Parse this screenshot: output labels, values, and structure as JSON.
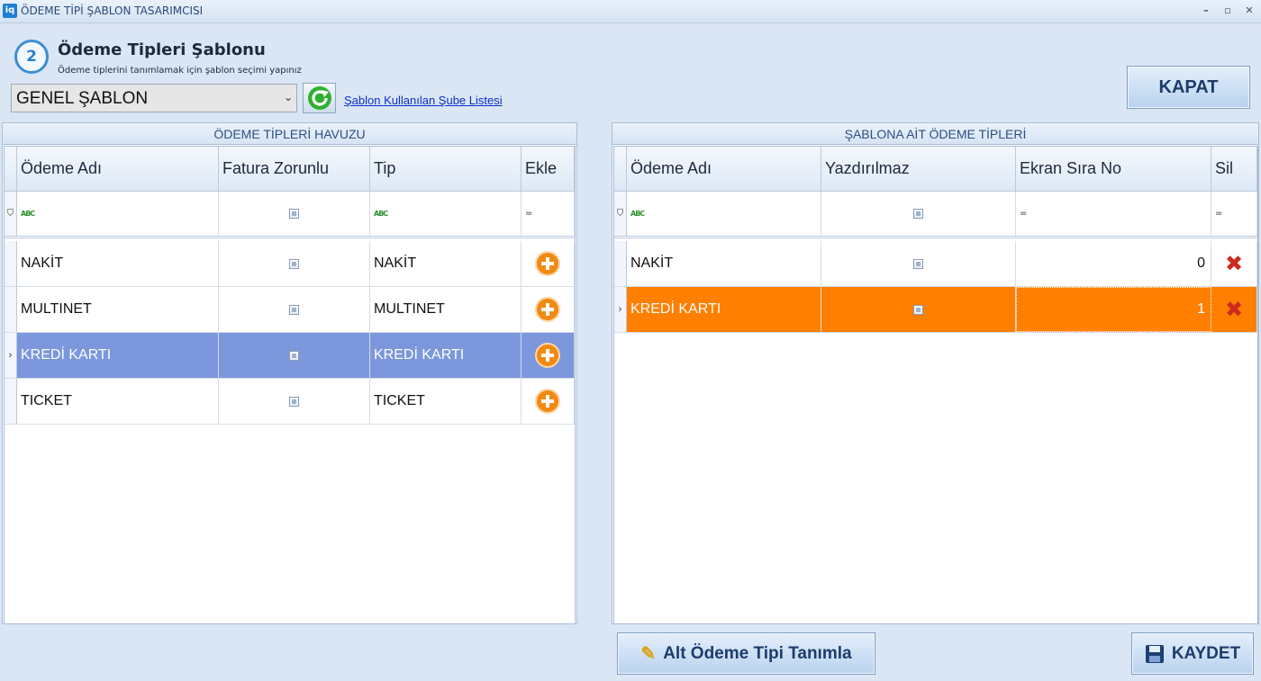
{
  "window": {
    "app_icon": "iq",
    "title": "ÖDEME TİPİ ŞABLON TASARIMCISI",
    "minimize": "–",
    "maximize": "▫",
    "close": "✕"
  },
  "header": {
    "step_number": "2",
    "title": "Ödeme Tipleri Şablonu",
    "subtitle": "Ödeme tiplerini tanımlamak için şablon seçimi yapınız"
  },
  "template_select": {
    "value": "GENEL ŞABLON",
    "arrow": "⌄"
  },
  "refresh_icon": "refresh-icon",
  "branch_link": "Şablon Kullanılan Şube Listesi",
  "close_button": "KAPAT",
  "pool": {
    "caption": "ÖDEME TİPLERİ HAVUZU",
    "columns": [
      "Ödeme Adı",
      "Fatura Zorunlu",
      "Tip",
      "Ekle"
    ],
    "filter": {
      "text_icon": "abc-filter-icon",
      "abc": "ABC",
      "equals": "="
    },
    "rows": [
      {
        "name": "NAKİT",
        "invoice_required": false,
        "type": "NAKİT"
      },
      {
        "name": "MULTINET",
        "invoice_required": false,
        "type": "MULTINET"
      },
      {
        "name": "KREDİ KARTI",
        "invoice_required": false,
        "type": "KREDİ KARTI",
        "selected": true
      },
      {
        "name": "TICKET",
        "invoice_required": false,
        "type": "TICKET"
      }
    ]
  },
  "template_types": {
    "caption": "ŞABLONA AİT ÖDEME TİPLERİ",
    "columns": [
      "Ödeme Adı",
      "Yazdırılmaz",
      "Ekran Sıra No",
      "Sil"
    ],
    "filter": {
      "abc": "ABC",
      "equals": "="
    },
    "rows": [
      {
        "name": "NAKİT",
        "not_printable": false,
        "order": "0"
      },
      {
        "name": "KREDİ KARTI",
        "not_printable": false,
        "order": "1",
        "selected": true
      }
    ]
  },
  "sub_type_button": "Alt Ödeme Tipi Tanımla",
  "save_button": "KAYDET",
  "row_indicator": "›",
  "colors": {
    "selected_blue": "#7c97dc",
    "selected_orange": "#ff7f00",
    "add_orange": "#f28a12",
    "delete_red": "#cc2a1f"
  }
}
